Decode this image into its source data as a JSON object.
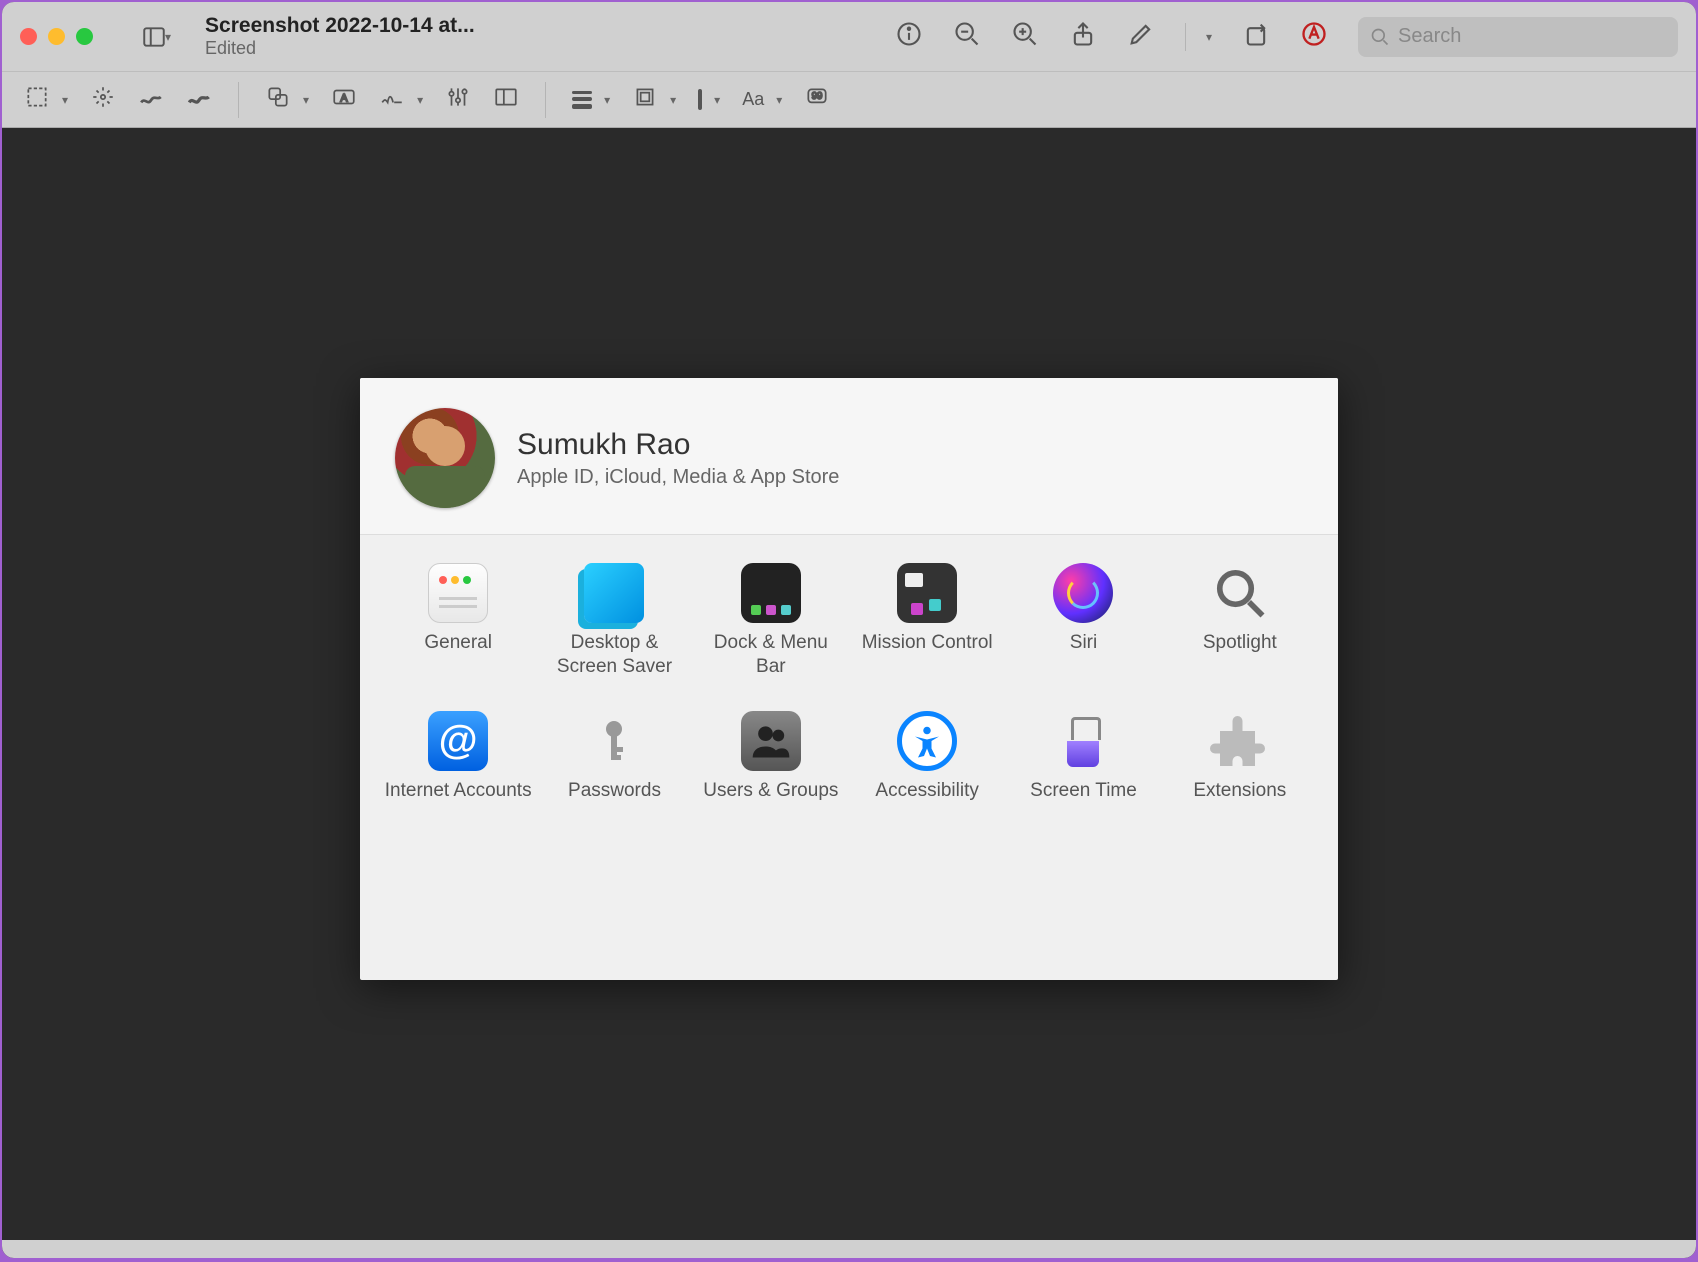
{
  "window": {
    "filename": "Screenshot 2022-10-14 at...",
    "status": "Edited",
    "search_placeholder": "Search"
  },
  "markup_tools": {
    "text_style_label": "Aa"
  },
  "syspref": {
    "profile_name": "Sumukh Rao",
    "profile_subtitle": "Apple ID, iCloud, Media & App Store",
    "items": [
      {
        "label": "General"
      },
      {
        "label": "Desktop & Screen Saver"
      },
      {
        "label": "Dock & Menu Bar"
      },
      {
        "label": "Mission Control"
      },
      {
        "label": "Siri"
      },
      {
        "label": "Spotlight"
      },
      {
        "label": "Internet Accounts"
      },
      {
        "label": "Passwords"
      },
      {
        "label": "Users & Groups"
      },
      {
        "label": "Accessibility"
      },
      {
        "label": "Screen Time"
      },
      {
        "label": "Extensions"
      }
    ]
  }
}
